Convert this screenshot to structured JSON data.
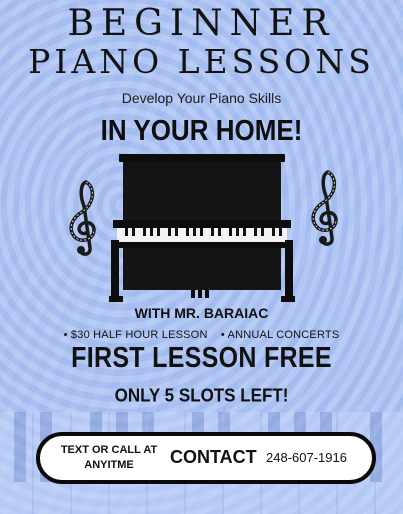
{
  "header": {
    "line1": "BEGINNER",
    "line2": "PIANO LESSONS",
    "subtitle": "Develop Your Piano Skills",
    "tagline": "IN YOUR HOME!"
  },
  "details": {
    "teacher": "WITH MR. BARAIAC",
    "bullet1": "• $30 HALF HOUR LESSON",
    "bullet2": "• ANNUAL CONCERTS",
    "offer": "FIRST LESSON FREE",
    "slots": "ONLY 5 SLOTS LEFT!"
  },
  "contact": {
    "prompt_line1": "TEXT OR CALL AT",
    "prompt_line2": "ANYITME",
    "label": "CONTACT",
    "phone": "248-607-1916"
  },
  "colors": {
    "background": "#a9c1f3",
    "piano": "#0d0d0d",
    "box_border": "#0a0a0a"
  },
  "icons": [
    "upright-piano-icon",
    "treble-clef-icon"
  ]
}
